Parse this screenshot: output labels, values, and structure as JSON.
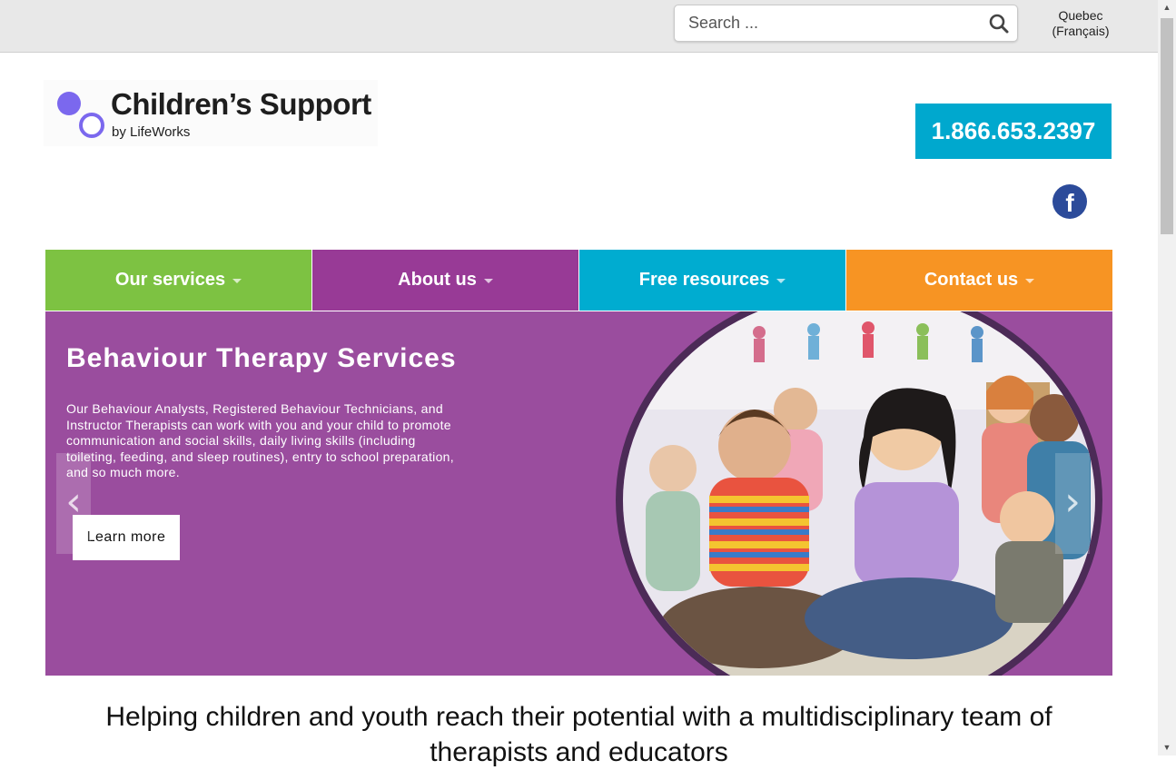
{
  "search": {
    "placeholder": "Search ..."
  },
  "language_link": {
    "line1": "Quebec",
    "line2": "(Français)"
  },
  "logo": {
    "title": "Children’s Support",
    "subtitle": "by LifeWorks"
  },
  "phone": "1.866.653.2397",
  "social": {
    "facebook_glyph": "f"
  },
  "nav": [
    {
      "label": "Our services",
      "color": "#7dc242"
    },
    {
      "label": "About us",
      "color": "#983a96"
    },
    {
      "label": "Free resources",
      "color": "#00acd0"
    },
    {
      "label": "Contact us",
      "color": "#f79423"
    }
  ],
  "hero": {
    "title": "Behaviour Therapy Services",
    "text": "Our Behaviour Analysts, Registered Behaviour Technicians, and Instructor Therapists can work with you and your child to promote communication and social skills, daily living skills (including toileting, feeding, and sleep routines), entry to school preparation, and so much more.",
    "button": "Learn more",
    "background": "#9a4d9e",
    "prev_glyph": "‹",
    "next_glyph": "›"
  },
  "tagline": "Helping children and youth reach their potential with a multidisciplinary team of therapists and educators"
}
